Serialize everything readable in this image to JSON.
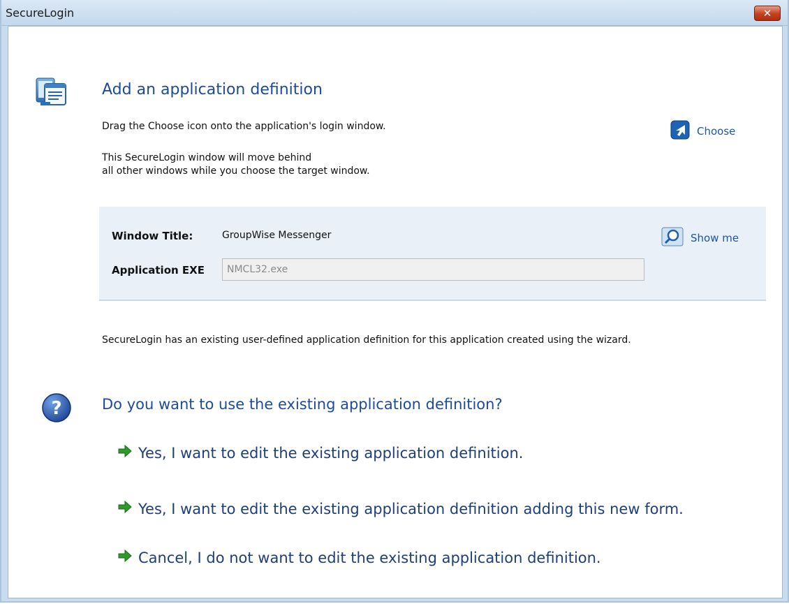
{
  "window": {
    "title": "SecureLogin",
    "close_symbol": "✕"
  },
  "header": {
    "title": "Add an application definition",
    "icon": "application-monitor-icon"
  },
  "instructions": {
    "line1": "Drag the Choose icon onto the application's login window.",
    "line2a": "This SecureLogin window will move behind",
    "line2b": "all other windows while you choose the target window."
  },
  "choose": {
    "label": "Choose",
    "icon": "pointer-arrow-icon"
  },
  "info_panel": {
    "window_title_label": "Window Title:",
    "window_title_value": "GroupWise Messenger",
    "exe_label": "Application EXE",
    "exe_value": "NMCL32.exe",
    "show_me_label": "Show me",
    "show_me_icon": "magnifier-icon"
  },
  "notice": "SecureLogin has an existing user-defined application definition for this application created using the wizard.",
  "question": {
    "title": "Do you want to use the existing application definition?",
    "icon": "help-question-icon"
  },
  "options": [
    {
      "label": "Yes, I want to edit the existing application definition.",
      "icon": "green-arrow-icon"
    },
    {
      "label": "Yes, I want to edit the existing application definition adding this new form.",
      "icon": "green-arrow-icon"
    },
    {
      "label": "Cancel, I do not want to edit the existing application definition.",
      "icon": "green-arrow-icon"
    }
  ],
  "colors": {
    "heading_blue": "#1d4a9b",
    "link_blue": "#1a56a6",
    "panel_bg": "#eaf0f7",
    "arrow_green": "#2e9a2a"
  }
}
